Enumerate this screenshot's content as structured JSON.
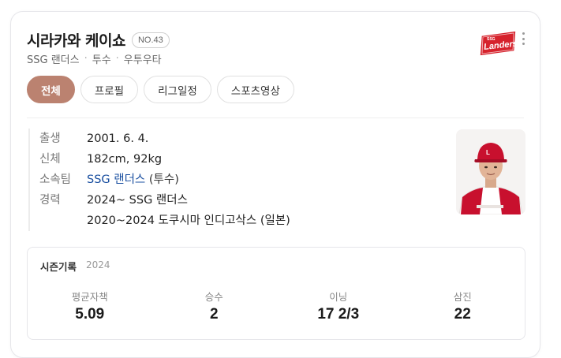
{
  "player": {
    "name": "시라카와 케이쇼",
    "number": "NO.43",
    "team": "SSG 랜더스",
    "position": "투수",
    "throw_bat": "우투우타"
  },
  "logo": {
    "text": "Landers",
    "small_text": "SSG",
    "color": "#d6222c"
  },
  "tabs": [
    {
      "label": "전체",
      "active": true
    },
    {
      "label": "프로필",
      "active": false
    },
    {
      "label": "리그일정",
      "active": false
    },
    {
      "label": "스포츠영상",
      "active": false
    }
  ],
  "profile": {
    "birth_label": "출생",
    "birth_value": "2001. 6. 4.",
    "body_label": "신체",
    "body_value": "182cm, 92kg",
    "team_label": "소속팀",
    "team_value": "SSG 랜더스",
    "team_pos": "(투수)",
    "career_label": "경력",
    "career": [
      "2024~ SSG 랜더스",
      "2020~2024 도쿠시마 인디고삭스 (일본)"
    ]
  },
  "season": {
    "title": "시즌기록",
    "year": "2024",
    "stats": [
      {
        "label": "평균자책",
        "value": "5.09"
      },
      {
        "label": "승수",
        "value": "2"
      },
      {
        "label": "이닝",
        "value": "17 2/3"
      },
      {
        "label": "삼진",
        "value": "22"
      }
    ]
  },
  "colors": {
    "accent": "#bb8270",
    "link": "#1a4fa0",
    "team_red": "#d6222c"
  }
}
